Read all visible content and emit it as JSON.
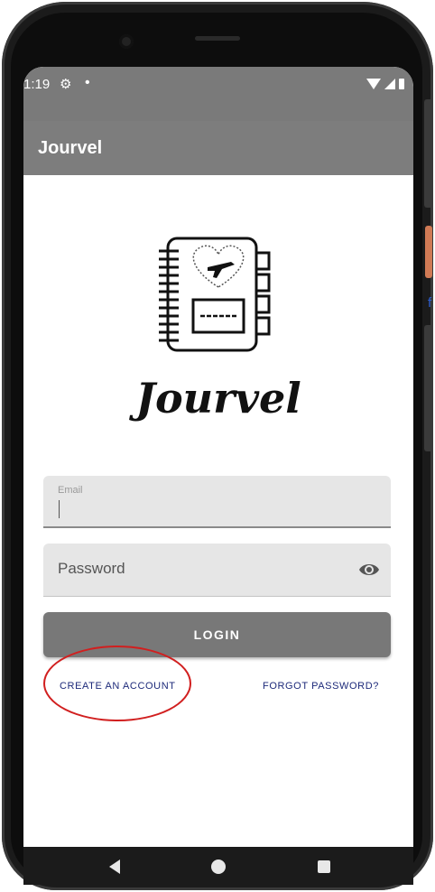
{
  "status_bar": {
    "time": "1:19",
    "gear_glyph": "⚙",
    "notification_dot": "•",
    "icons": [
      "wifi-icon",
      "signal-icon",
      "battery-icon"
    ]
  },
  "app_bar": {
    "title": "Jourvel"
  },
  "logo": {
    "brand_text": "Jourvel",
    "icon": "notebook-airplane-heart-logo"
  },
  "form": {
    "email": {
      "label": "Email",
      "value": ""
    },
    "password": {
      "placeholder": "Password",
      "value": "",
      "toggle_icon": "eye-icon"
    },
    "login_label": "LOGIN",
    "create_account_label": "CREATE AN ACCOUNT",
    "forgot_password_label": "FORGOT PASSWORD?"
  },
  "device": {
    "side_label": "f"
  },
  "colors": {
    "status_bar_bg": "#7a7a7a",
    "app_bar_bg": "#7d7d7d",
    "button_bg": "#787878",
    "link_color": "#1d2a7a",
    "annotation_red": "#d11f1f"
  },
  "nav_bar": {
    "icons": [
      "back-icon",
      "home-icon",
      "recents-icon"
    ]
  }
}
